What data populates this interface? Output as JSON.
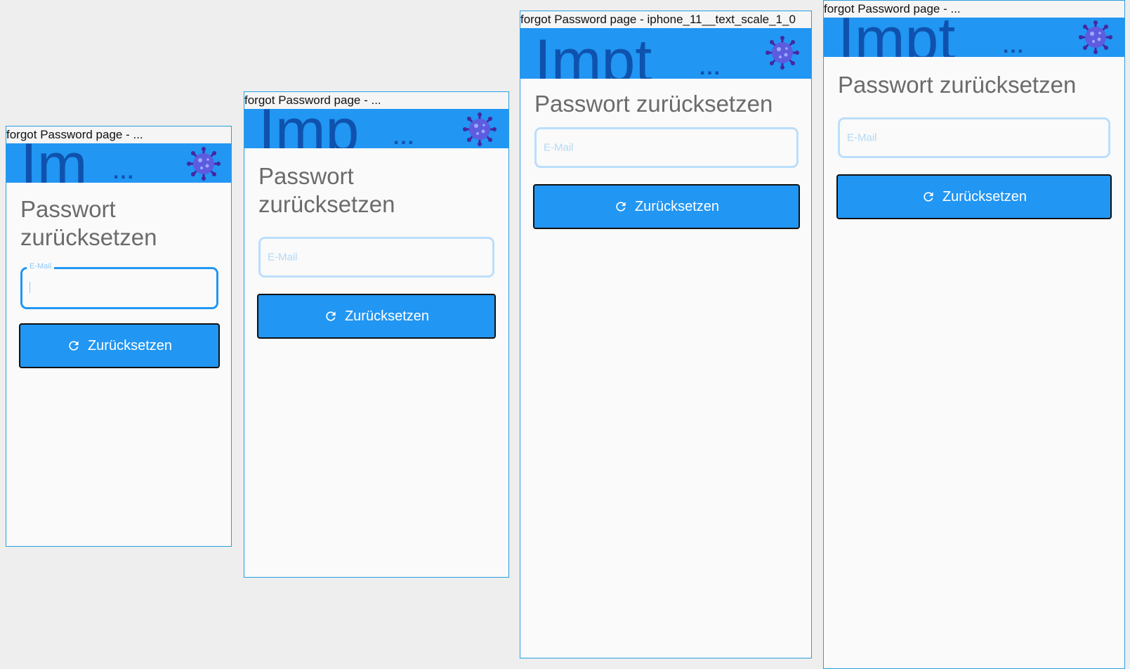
{
  "frames": [
    {
      "label": "forgot Password page - ...",
      "appbar_title": "Im",
      "title_line1": "Passwort",
      "title_line2": "zurücksetzen",
      "email_label": "E-Mail",
      "button_label": "Zurücksetzen"
    },
    {
      "label": "forgot Password page - ...",
      "appbar_title": "Imp",
      "title_line1": "Passwort",
      "title_line2": "zurücksetzen",
      "email_placeholder": "E-Mail",
      "button_label": "Zurücksetzen"
    },
    {
      "label": "forgot Password page - iphone_11__text_scale_1_0",
      "appbar_title": "Impt",
      "title": "Passwort zurücksetzen",
      "email_placeholder": "E-Mail",
      "button_label": "Zurücksetzen"
    },
    {
      "label": "forgot Password page - ...",
      "appbar_title": "Impt",
      "title": "Passwort zurücksetzen",
      "email_placeholder": "E-Mail",
      "button_label": "Zurücksetzen"
    }
  ],
  "appbar_ellipsis": "...",
  "colors": {
    "appbar": "#2196f3",
    "button": "#2196f3",
    "field_border": "#bbdefb",
    "title_text": "#6b6b6b",
    "background": "#eeeeee"
  },
  "icons": [
    "virus-icon",
    "refresh-icon"
  ]
}
